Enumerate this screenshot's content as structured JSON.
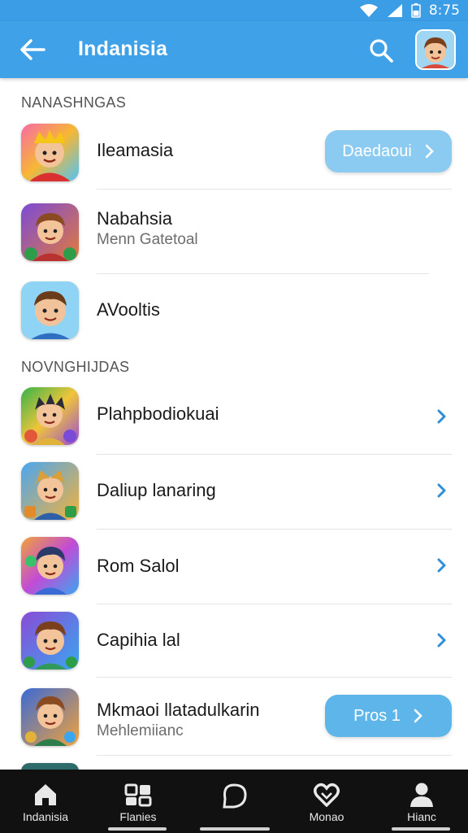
{
  "status": {
    "time": "8:75"
  },
  "appbar": {
    "title": "Indanisia"
  },
  "sections": [
    {
      "header": "NANASHNGAS"
    },
    {
      "header": "NOVNGHIJDAS"
    }
  ],
  "rows": [
    {
      "title": "Ileamasia",
      "button": "Daedaoui"
    },
    {
      "title": "Nabahsia",
      "subtitle": "Menn Gatetoal"
    },
    {
      "title": "AVooltis"
    },
    {
      "title": "Plahpbodiokuai"
    },
    {
      "title": "Daliup lanaring"
    },
    {
      "title": "Rom Salol"
    },
    {
      "title": "Capihia lal"
    },
    {
      "title": "Mkmaoi llatadulkarin",
      "subtitle": "Mehlemiianc",
      "button": "Pros 1"
    }
  ],
  "bottom_nav": [
    {
      "label": "Indanisia",
      "icon": "home-icon"
    },
    {
      "label": "Flanies",
      "icon": "grid-icon"
    },
    {
      "label": "",
      "icon": "chat-bubble-icon"
    },
    {
      "label": "Monao",
      "icon": "heart-icon"
    },
    {
      "label": "Hianc",
      "icon": "person-icon"
    }
  ],
  "colors": {
    "primary": "#3fa1e8",
    "button": "#5db5ea",
    "chevron": "#2f8fd8",
    "nav_bg": "#111111"
  }
}
